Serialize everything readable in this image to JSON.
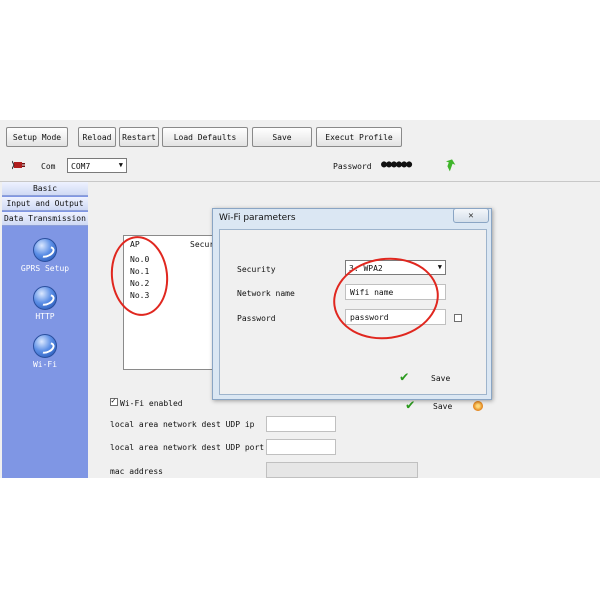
{
  "toolbar": {
    "setup_mode": "Setup Mode",
    "reload": "Reload",
    "restart": "Restart",
    "load_defaults": "Load Defaults",
    "save": "Save",
    "execut_profile": "Execut Profile"
  },
  "connection": {
    "com_label": "Com",
    "com_value": "COM7",
    "password_label": "Password",
    "password_mask": "●●●●●●"
  },
  "sidebar": {
    "headers": [
      "Basic",
      "Input and Output",
      "Data Transmission"
    ],
    "items": [
      {
        "label": "GPRS Setup",
        "icon": "globe-icon"
      },
      {
        "label": "HTTP",
        "icon": "globe-icon"
      },
      {
        "label": "Wi-Fi",
        "icon": "globe-icon"
      }
    ]
  },
  "ap_list": {
    "col_ap": "AP",
    "col_security": "Secur",
    "items": [
      "No.0",
      "No.1",
      "No.2",
      "No.3"
    ]
  },
  "main": {
    "wifi_enabled_label": "Wi-Fi enabled",
    "wifi_enabled_checked": true,
    "save_label": "Save",
    "dest_ip_label": "local area network dest UDP ip",
    "dest_port_label": "local area network dest UDP port",
    "mac_label": "mac address"
  },
  "dialog": {
    "title": "Wi-Fi parameters",
    "security_label": "Security",
    "security_value": "3: WPA2",
    "network_name_label": "Network name",
    "network_name_value": "Wifi name",
    "password_label": "Password",
    "password_value": "password",
    "save_label": "Save"
  },
  "colors": {
    "sidebar": "#7f96e4",
    "annotation": "#e0271f",
    "dialog_frame": "#dbe7f3"
  }
}
